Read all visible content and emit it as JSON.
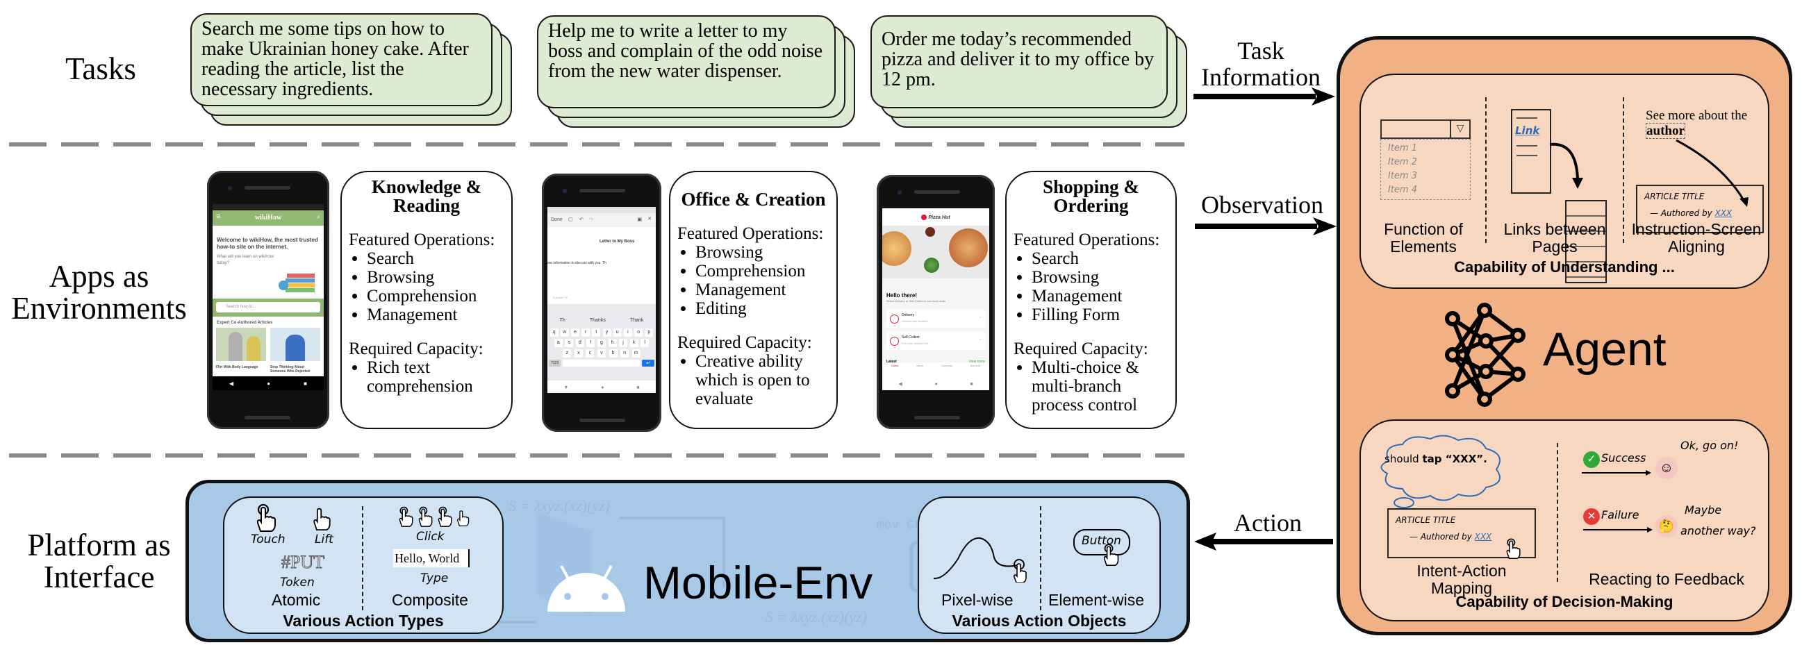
{
  "rows": {
    "tasks": "Tasks",
    "apps_line1": "Apps as",
    "apps_line2": "Environments",
    "platform_line1": "Platform as",
    "platform_line2": "Interface"
  },
  "tasks": [
    {
      "text": "Search me some tips on how to make Ukrainian honey cake. After reading the article, list the necessary ingredients."
    },
    {
      "text": "Help me to write a letter to my boss and complain of the odd noise from the new water dispenser."
    },
    {
      "text": "Order me today’s recommended pizza and deliver it to my office by 12 pm."
    }
  ],
  "apps": [
    {
      "title": "Knowledge & Reading",
      "featured_label": "Featured Operations:",
      "featured": [
        "Search",
        "Browsing",
        "Comprehension",
        "Management"
      ],
      "capacity_label": "Required Capacity:",
      "capacity": [
        "Rich text comprehension"
      ],
      "screen": {
        "app_name": "wikiHow",
        "welcome": "Welcome to wikiHow, the most trusted how-to site on the internet.",
        "prompt": "What will you learn on wikiHow today?",
        "search_placeholder": "Search how to...",
        "section": "Expert Co-Authored Articles",
        "article1": "Flirt With Body Language",
        "article2": "Stop Thinking About Someone Who Rejected"
      }
    },
    {
      "title": "Office & Creation",
      "featured_label": "Featured Operations:",
      "featured": [
        "Browsing",
        "Comprehension",
        "Management",
        "Editing"
      ],
      "capacity_label": "Required Capacity:",
      "capacity": [
        "Creative ability which is open to evaluate"
      ],
      "screen": {
        "done": "Done",
        "doc_title": "Letter to My Boss",
        "body": "me information to discuss with you. Th",
        "fulltext": "Full text: 79",
        "suggestions": [
          "Th",
          "Thanks",
          "Thank"
        ],
        "keys_row1": [
          "q",
          "w",
          "e",
          "r",
          "t",
          "y",
          "u",
          "i",
          "o",
          "p"
        ],
        "keys_row2": [
          "a",
          "s",
          "d",
          "f",
          "g",
          "h",
          "j",
          "k",
          "l"
        ],
        "keys_row3": [
          "z",
          "x",
          "c",
          "v",
          "b",
          "n",
          "m"
        ],
        "sym": "?123"
      }
    },
    {
      "title": "Shopping & Ordering",
      "featured_label": "Featured Operations:",
      "featured": [
        "Search",
        "Browsing",
        "Management",
        "Filling Form"
      ],
      "capacity_label": "Required Capacity:",
      "capacity": [
        "Multi-choice & multi-branch process control"
      ],
      "screen": {
        "brand": "Pizza Hut",
        "hello": "Hello there!",
        "sub": "Select Delivery or Self-Collect to see local deals",
        "delivery": "Delivery",
        "delivery_sub": "Choose your location",
        "collect": "Self-Collect",
        "collect_sub": "Find your nearest Hut",
        "latest": "Latest",
        "view_more": "View more",
        "nav": [
          "Home",
          "Menu",
          "Coupons",
          "Account"
        ]
      }
    }
  ],
  "arrows": {
    "task_line1": "Task",
    "task_line2": "Information",
    "observation": "Observation",
    "action": "Action"
  },
  "platform": {
    "name": "Mobile-Env",
    "action_types": {
      "title": "Various Action Types",
      "atomic": "Atomic",
      "composite": "Composite",
      "touch": "Touch",
      "lift": "Lift",
      "token": "Token",
      "token_glyph": "#PUT",
      "click": "Click",
      "type": "Type",
      "typed_text": "Hello, World"
    },
    "action_objects": {
      "title": "Various Action Objects",
      "pixel": "Pixel-wise",
      "element": "Element-wise",
      "button": "Button"
    }
  },
  "agent": {
    "name": "Agent",
    "understanding": {
      "title": "Capability of Understanding ...",
      "items": [
        {
          "line1": "Function of",
          "line2": "Elements"
        },
        {
          "line1": "Links between",
          "line2": "Pages"
        },
        {
          "line1": "Instruction-Screen",
          "line2": "Aligning"
        }
      ],
      "dropdown_items": [
        "Item 1",
        "Item 2",
        "Item 3",
        "Item 4"
      ],
      "link_text": "Link",
      "instruction": "See more about the",
      "instruction_bold": "author",
      "article_title": "ARTICLE TITLE",
      "authored_by": "Authored by",
      "author_link": "XXX"
    },
    "decision": {
      "title": "Capability of Decision-Making",
      "items": [
        {
          "line1": "Intent-Action",
          "line2": "Mapping"
        },
        {
          "line1": "Reacting to Feedback",
          "line2": ""
        }
      ],
      "thought": "should",
      "thought_bold": "tap “XXX”.",
      "success": "Success",
      "success_reply": "Ok, go on!",
      "failure": "Failure",
      "failure_reply1": "Maybe",
      "failure_reply2": "another way?"
    }
  },
  "colors": {
    "task_green": "#dcebd1",
    "platform_blue": "#a8c8e8",
    "agent_orange": "#f2b184",
    "agent_panel": "#f7d7c0",
    "wikihow_green": "#93b874",
    "pizza_red": "#e31837",
    "link_blue": "#2f6db5"
  }
}
